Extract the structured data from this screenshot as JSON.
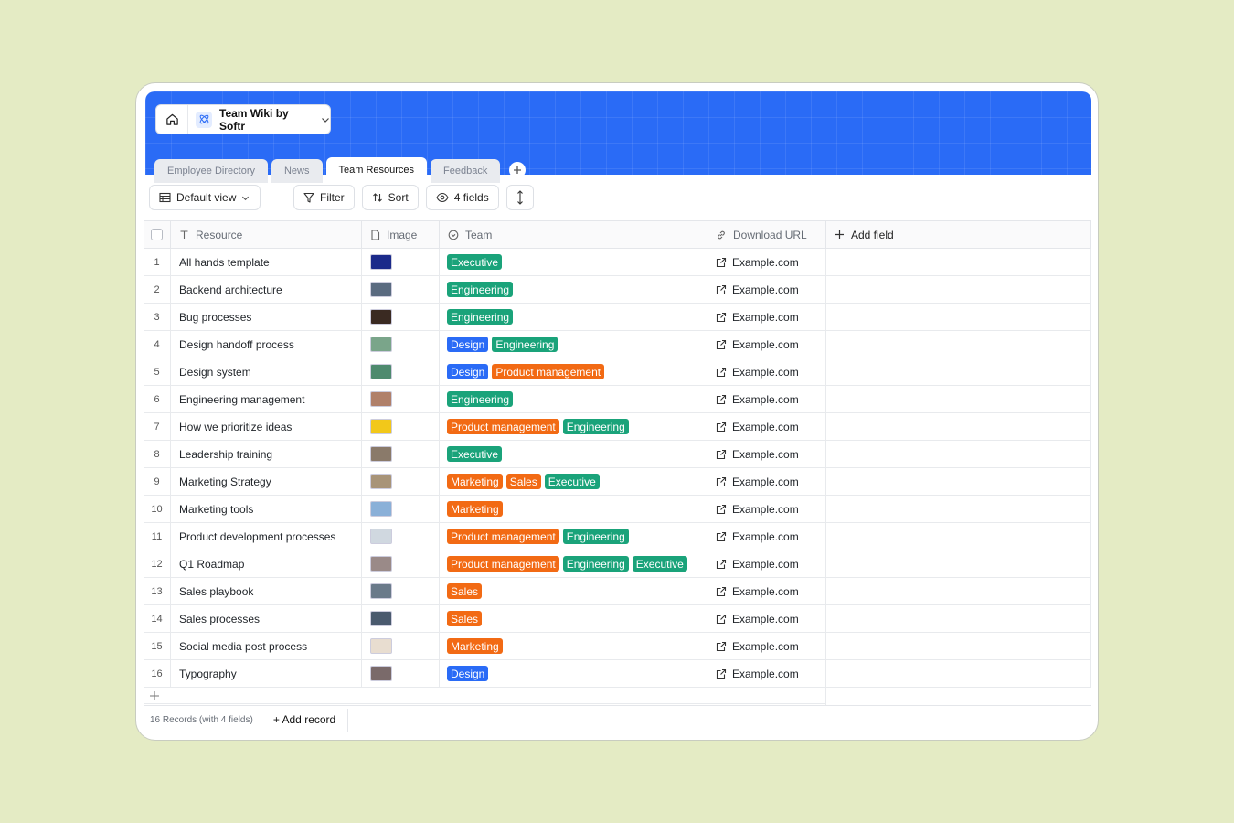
{
  "app": {
    "name": "Team Wiki by Softr",
    "accent": "#2a6bf6"
  },
  "tabs": [
    {
      "label": "Employee Directory",
      "active": false
    },
    {
      "label": "News",
      "active": false
    },
    {
      "label": "Team Resources",
      "active": true
    },
    {
      "label": "Feedback",
      "active": false
    }
  ],
  "toolbar": {
    "view_label": "Default view",
    "filter_label": "Filter",
    "sort_label": "Sort",
    "fields_label": "4 fields"
  },
  "columns": {
    "resource": "Resource",
    "image": "Image",
    "team": "Team",
    "url": "Download URL",
    "add_field": "Add field"
  },
  "tag_colors": {
    "Executive": "#1aa37a",
    "Engineering": "#1aa37a",
    "Design": "#2a6bf6",
    "Product management": "#f26a14",
    "Marketing": "#f26a14",
    "Sales": "#f26a14"
  },
  "rows": [
    {
      "num": "1",
      "resource": "All hands template",
      "thumb": "#1b2a8a",
      "teams": [
        "Executive"
      ],
      "url": "Example.com"
    },
    {
      "num": "2",
      "resource": "Backend architecture",
      "thumb": "#5a6b80",
      "teams": [
        "Engineering"
      ],
      "url": "Example.com"
    },
    {
      "num": "3",
      "resource": "Bug processes",
      "thumb": "#3a2a22",
      "teams": [
        "Engineering"
      ],
      "url": "Example.com"
    },
    {
      "num": "4",
      "resource": "Design handoff process",
      "thumb": "#7aa58a",
      "teams": [
        "Design",
        "Engineering"
      ],
      "url": "Example.com"
    },
    {
      "num": "5",
      "resource": "Design system",
      "thumb": "#4e8a6e",
      "teams": [
        "Design",
        "Product management"
      ],
      "url": "Example.com"
    },
    {
      "num": "6",
      "resource": "Engineering management",
      "thumb": "#b0806a",
      "teams": [
        "Engineering"
      ],
      "url": "Example.com"
    },
    {
      "num": "7",
      "resource": "How we prioritize ideas",
      "thumb": "#f2c81a",
      "teams": [
        "Product management",
        "Engineering"
      ],
      "url": "Example.com"
    },
    {
      "num": "8",
      "resource": "Leadership training",
      "thumb": "#8a7a6a",
      "teams": [
        "Executive"
      ],
      "url": "Example.com"
    },
    {
      "num": "9",
      "resource": "Marketing Strategy",
      "thumb": "#a89478",
      "teams": [
        "Marketing",
        "Sales",
        "Executive"
      ],
      "url": "Example.com"
    },
    {
      "num": "10",
      "resource": "Marketing tools",
      "thumb": "#8ab0d8",
      "teams": [
        "Marketing"
      ],
      "url": "Example.com"
    },
    {
      "num": "11",
      "resource": "Product development processes",
      "thumb": "#d0d8e0",
      "teams": [
        "Product management",
        "Engineering"
      ],
      "url": "Example.com"
    },
    {
      "num": "12",
      "resource": "Q1 Roadmap",
      "thumb": "#9a8a88",
      "teams": [
        "Product management",
        "Engineering",
        "Executive"
      ],
      "url": "Example.com"
    },
    {
      "num": "13",
      "resource": "Sales playbook",
      "thumb": "#6a7a8a",
      "teams": [
        "Sales"
      ],
      "url": "Example.com"
    },
    {
      "num": "14",
      "resource": "Sales processes",
      "thumb": "#4a5a6e",
      "teams": [
        "Sales"
      ],
      "url": "Example.com"
    },
    {
      "num": "15",
      "resource": "Social media post process",
      "thumb": "#e8ddd0",
      "teams": [
        "Marketing"
      ],
      "url": "Example.com"
    },
    {
      "num": "16",
      "resource": "Typography",
      "thumb": "#7a6a6a",
      "teams": [
        "Design"
      ],
      "url": "Example.com"
    }
  ],
  "footer": {
    "count": "16 Records (with 4 fields)",
    "add_record": "+ Add record"
  }
}
